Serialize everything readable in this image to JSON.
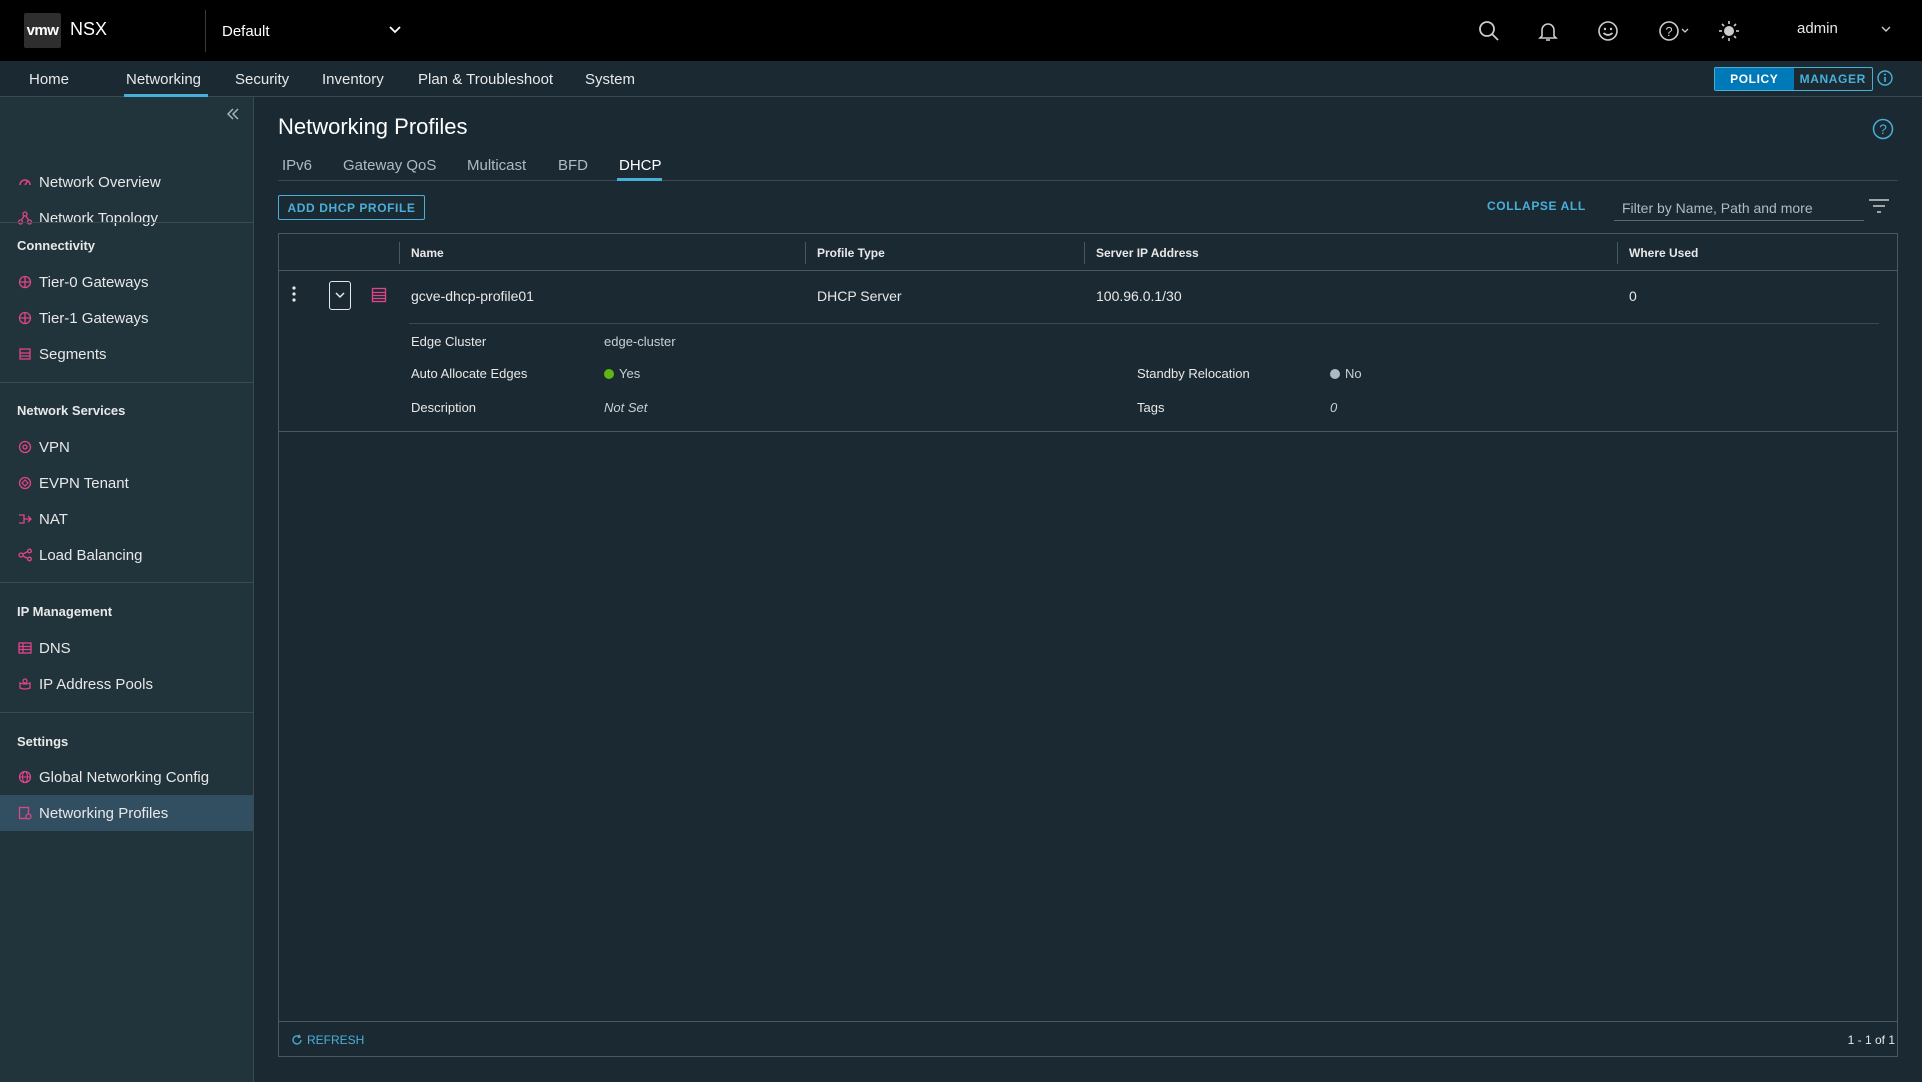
{
  "header": {
    "logo": "vmw",
    "app_name": "NSX",
    "project": "Default",
    "user": "admin"
  },
  "nav": {
    "tabs": [
      "Home",
      "Networking",
      "Security",
      "Inventory",
      "Plan & Troubleshoot",
      "System"
    ],
    "active": "Networking",
    "mode_policy": "POLICY",
    "mode_manager": "MANAGER"
  },
  "sidebar": {
    "top_items": [
      "Network Overview",
      "Network Topology"
    ],
    "sections": [
      {
        "title": "Connectivity",
        "items": [
          "Tier-0 Gateways",
          "Tier-1 Gateways",
          "Segments"
        ]
      },
      {
        "title": "Network Services",
        "items": [
          "VPN",
          "EVPN Tenant",
          "NAT",
          "Load Balancing"
        ]
      },
      {
        "title": "IP Management",
        "items": [
          "DNS",
          "IP Address Pools"
        ]
      },
      {
        "title": "Settings",
        "items": [
          "Global Networking Config",
          "Networking Profiles"
        ]
      }
    ],
    "active": "Networking Profiles"
  },
  "page": {
    "title": "Networking Profiles",
    "subtabs": [
      "IPv6",
      "Gateway QoS",
      "Multicast",
      "BFD",
      "DHCP"
    ],
    "active_subtab": "DHCP",
    "add_button": "ADD DHCP PROFILE",
    "collapse_all": "COLLAPSE ALL",
    "filter_placeholder": "Filter by Name, Path and more"
  },
  "grid": {
    "columns": [
      "Name",
      "Profile Type",
      "Server IP Address",
      "Where Used"
    ],
    "row": {
      "name": "gcve-dhcp-profile01",
      "profile_type": "DHCP Server",
      "server_ip": "100.96.0.1/30",
      "where_used": "0"
    },
    "details": {
      "edge_cluster_label": "Edge Cluster",
      "edge_cluster_value": "edge-cluster",
      "auto_allocate_label": "Auto Allocate Edges",
      "auto_allocate_value": "Yes",
      "description_label": "Description",
      "description_value": "Not Set",
      "standby_label": "Standby Relocation",
      "standby_value": "No",
      "tags_label": "Tags",
      "tags_value": "0"
    },
    "refresh": "REFRESH",
    "pagination": "1 - 1 of 1"
  },
  "colors": {
    "accent": "#49afd9",
    "status_yes": "#60b515",
    "status_no": "#adbbc4",
    "icon_pink": "#e0448a"
  }
}
